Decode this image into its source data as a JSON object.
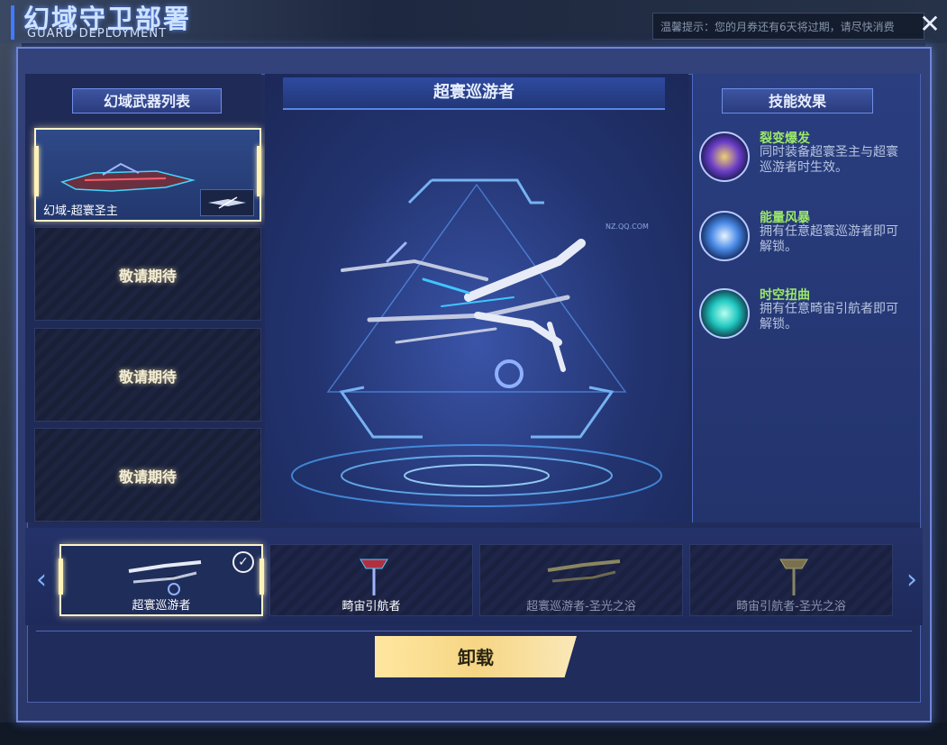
{
  "header": {
    "title_cn": "幻域守卫部署",
    "title_en": "GUARD DEPLOYMENT"
  },
  "notice": {
    "text": "温馨提示：您的月券还有6天将过期，请尽快消费"
  },
  "weapon_list": {
    "header": "幻域武器列表",
    "slots": [
      {
        "name": "幻域-超寰圣主",
        "filled": true
      },
      {
        "name": "敬请期待",
        "filled": false
      },
      {
        "name": "敬请期待",
        "filled": false
      },
      {
        "name": "敬请期待",
        "filled": false
      }
    ]
  },
  "center": {
    "title": "超寰巡游者",
    "watermark": "NZ.QQ.COM"
  },
  "skills": {
    "header": "技能效果",
    "items": [
      {
        "name": "裂变爆发",
        "desc": "同时装备超寰圣主与超寰巡游者时生效。",
        "icon": "lightning-icon"
      },
      {
        "name": "能量风暴",
        "desc": "拥有任意超寰巡游者即可解锁。",
        "icon": "arrow-up-icon"
      },
      {
        "name": "时空扭曲",
        "desc": "拥有任意畸宙引航者即可解锁。",
        "icon": "vortex-icon"
      }
    ]
  },
  "carousel": {
    "items": [
      {
        "label": "超寰巡游者",
        "selected": true,
        "locked": false
      },
      {
        "label": "畸宙引航者",
        "selected": false,
        "locked": false
      },
      {
        "label": "超寰巡游者-圣光之浴",
        "selected": false,
        "locked": true
      },
      {
        "label": "畸宙引航者-圣光之浴",
        "selected": false,
        "locked": true
      }
    ]
  },
  "actions": {
    "unload_label": "卸载"
  },
  "colors": {
    "panel": "#2a376a",
    "accent_gold": "#f6d684",
    "skill_name_green": "#9be86a"
  }
}
